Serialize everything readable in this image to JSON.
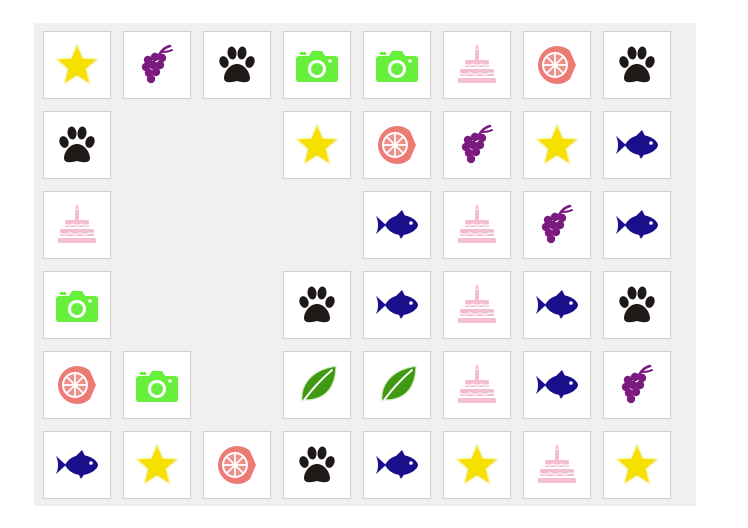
{
  "board": {
    "rows": 6,
    "cols": 8,
    "background": "#f0f0f0",
    "tile_background": "#ffffff",
    "grid": [
      [
        "star",
        "grapes",
        "paw",
        "camera",
        "camera",
        "cake",
        "orange",
        "paw"
      ],
      [
        "paw",
        null,
        null,
        "star",
        "orange",
        "grapes",
        "star",
        "fish"
      ],
      [
        "cake",
        null,
        null,
        null,
        "fish",
        "cake",
        "grapes",
        "fish"
      ],
      [
        "camera",
        null,
        null,
        "paw",
        "fish",
        "cake",
        "fish",
        "paw"
      ],
      [
        "orange",
        "camera",
        null,
        "leaf",
        "leaf",
        "cake",
        "fish",
        "grapes"
      ],
      [
        "fish",
        "star",
        "orange",
        "paw",
        "fish",
        "star",
        "cake",
        "star"
      ]
    ]
  },
  "icons": {
    "star": {
      "name": "star-icon",
      "color": "#f5e000"
    },
    "grapes": {
      "name": "grapes-icon",
      "color": "#7b1a7f"
    },
    "paw": {
      "name": "paw-icon",
      "color": "#1f1a17"
    },
    "camera": {
      "name": "camera-icon",
      "color": "#66f03c"
    },
    "cake": {
      "name": "cake-icon",
      "color": "#f4bfcc"
    },
    "orange": {
      "name": "orange-slice-icon",
      "color": "#ec7b74"
    },
    "fish": {
      "name": "fish-icon",
      "color": "#1a0f8a"
    },
    "leaf": {
      "name": "leaf-icon",
      "color": "#3f9a12"
    }
  }
}
